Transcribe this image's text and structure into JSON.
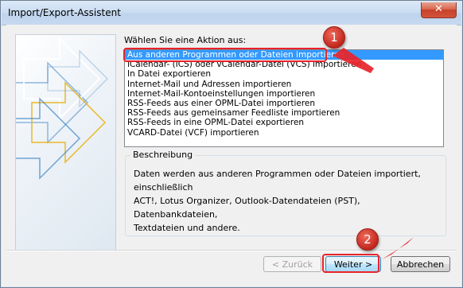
{
  "window": {
    "title": "Import/Export-Assistent",
    "close_symbol": "✕"
  },
  "action_label": "Wählen Sie eine Aktion aus:",
  "actions": [
    "Aus anderen Programmen oder Dateien importieren",
    "iCalendar- (ICS) oder vCalendar-Datei (VCS) importieren",
    "In Datei exportieren",
    "Internet-Mail und Adressen importieren",
    "Internet-Mail-Kontoeinstellungen importieren",
    "RSS-Feeds aus einer OPML-Datei importieren",
    "RSS-Feeds aus gemeinsamer Feedliste importieren",
    "RSS-Feeds in eine OPML-Datei exportieren",
    "VCARD-Datei (VCF) importieren"
  ],
  "selected_index": 0,
  "description": {
    "title": "Beschreibung",
    "lines": [
      "Daten werden aus anderen Programmen oder Dateien importiert, einschließlich",
      "ACT!, Lotus Organizer, Outlook-Datendateien (PST), Datenbankdateien,",
      "Textdateien und andere."
    ]
  },
  "buttons": {
    "back": "< Zurück",
    "next": "Weiter >",
    "cancel": "Abbrechen"
  },
  "annotations": {
    "marker_1": "1",
    "marker_2": "2"
  },
  "colors": {
    "highlight": "#e8232a",
    "selection": "#3399ff",
    "art_blue": "#3b82c4",
    "art_gold": "#e8b928"
  }
}
